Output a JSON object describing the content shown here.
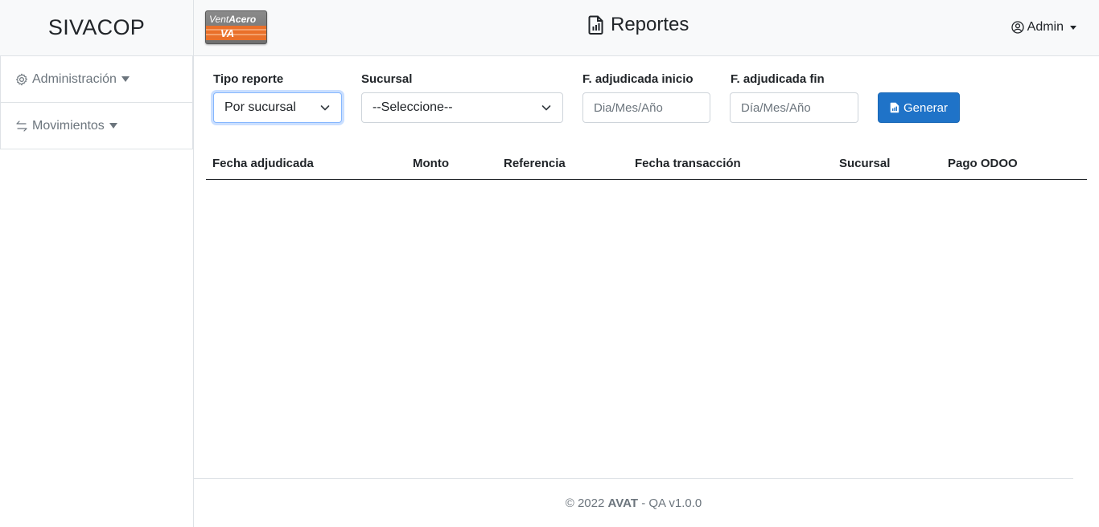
{
  "sidebar": {
    "brand": "SIVACOP",
    "items": [
      {
        "label": "Administración",
        "icon": "gear-icon"
      },
      {
        "label": "Movimientos",
        "icon": "arrows-exchange-icon"
      }
    ]
  },
  "header": {
    "logo_text_1": "Vent",
    "logo_text_2": "Acero",
    "logo_mark": "VA",
    "title": "Reportes",
    "title_icon": "file-chart-icon",
    "user": "Admin",
    "user_icon": "user-circle-icon"
  },
  "filters": {
    "tipo_label": "Tipo reporte",
    "tipo_value": "Por sucursal",
    "sucursal_label": "Sucursal",
    "sucursal_value": "--Seleccione--",
    "inicio_label": "F. adjudicada inicio",
    "inicio_placeholder": "Dia/Mes/Año",
    "fin_label": "F. adjudicada fin",
    "fin_placeholder": "Día/Mes/Año",
    "generar_label": "Generar"
  },
  "table": {
    "columns": [
      "Fecha adjudicada",
      "Monto",
      "Referencia",
      "Fecha transacción",
      "Sucursal",
      "Pago ODOO"
    ],
    "rows": []
  },
  "footer": {
    "copyright": "© 2022",
    "company": "AVAT",
    "env": "- QA v1.0.0"
  },
  "colors": {
    "primary": "#1f73c8",
    "logo_orange": "#e9702a"
  }
}
